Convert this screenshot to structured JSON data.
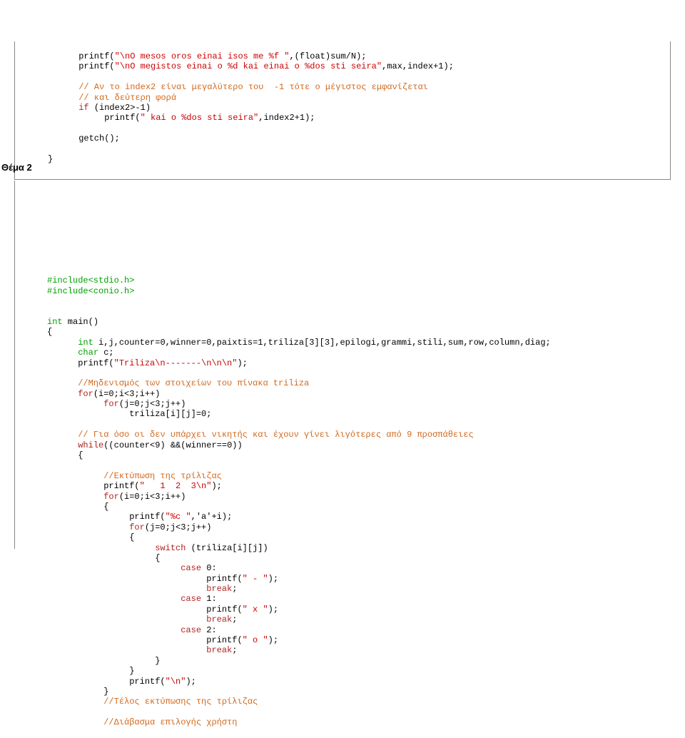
{
  "block1": {
    "l1a": "      printf(",
    "l1b": "\"\\nO mesos oros einai isos me %f \"",
    "l1c": ",(float)sum/N);",
    "l2a": "      printf(",
    "l2b": "\"\\nO megistos einai o %d kai einai o %dos sti seira\"",
    "l2c": ",max,index+1);",
    "l3": "      // Αν το index2 είναι μεγαλύτερο του  -1 τότε ο μέγιστος εμφανίζεται",
    "l4": "      // και δεύτερη φορά",
    "l5a": "      ",
    "l5b": "if",
    "l5c": " (index2>-1)",
    "l6a": "           printf(",
    "l6b": "\" kai o %dos sti seira\"",
    "l6c": ",index2+1);",
    "l7": "      getch();",
    "l8": "}"
  },
  "label": "Θέμα 2",
  "block2": {
    "inc1": "#include<stdio.h>",
    "inc2": "#include<conio.h>",
    "m1a": "int",
    "m1b": " main()",
    "m2": "{",
    "m3a": "      ",
    "m3b": "int",
    "m3c": " i,j,counter=0,winner=0,paixtis=1,triliza[3][3],epilogi,grammi,stili,sum,row,column,diag;",
    "m4a": "      ",
    "m4b": "char",
    "m4c": " c;",
    "m5a": "      printf(",
    "m5b": "\"Triliza\\n-------\\n\\n\\n\"",
    "m5c": ");",
    "m6": "      //Μηδενισμός των στοιχείων του πίνακα triliza",
    "m7a": "      ",
    "m7b": "for",
    "m7c": "(i=0;i<3;i++)",
    "m8a": "           ",
    "m8b": "for",
    "m8c": "(j=0;j<3;j++)",
    "m9": "                triliza[i][j]=0;",
    "m10": "      // Για όσο οι δεν υπάρχει νικητής και έχουν γίνει λιγότερες από 9 προσπάθειες",
    "m11a": "      ",
    "m11b": "while",
    "m11c": "((counter<9) &&(winner==0))",
    "m12": "      {",
    "m13": "           //Εκτύπωση της τρίλιζας",
    "m14a": "           printf(",
    "m14b": "\"   1  2  3\\n\"",
    "m14c": ");",
    "m15a": "           ",
    "m15b": "for",
    "m15c": "(i=0;i<3;i++)",
    "m16": "           {",
    "m17a": "                printf(",
    "m17b": "\"%c \"",
    "m17c": ",'a'+i);",
    "m18a": "                ",
    "m18b": "for",
    "m18c": "(j=0;j<3;j++)",
    "m19": "                {",
    "m20a": "                     ",
    "m20b": "switch",
    "m20c": " (triliza[i][j])",
    "m21": "                     {",
    "m22a": "                          ",
    "m22b": "case",
    "m22c": " 0:",
    "m23a": "                               printf(",
    "m23b": "\" - \"",
    "m23c": ");",
    "m24a": "                               ",
    "m24b": "break",
    "m24c": ";",
    "m25a": "                          ",
    "m25b": "case",
    "m25c": " 1:",
    "m26a": "                               printf(",
    "m26b": "\" x \"",
    "m26c": ");",
    "m27a": "                               ",
    "m27b": "break",
    "m27c": ";",
    "m28a": "                          ",
    "m28b": "case",
    "m28c": " 2:",
    "m29a": "                               printf(",
    "m29b": "\" o \"",
    "m29c": ");",
    "m30a": "                               ",
    "m30b": "break",
    "m30c": ";",
    "m31": "                     }",
    "m32": "                }",
    "m33a": "                printf(",
    "m33b": "\"\\n\"",
    "m33c": ");",
    "m34": "           }",
    "m35": "           //Τέλος εκτύπωσης της τρίλιζας",
    "m36": "           //Διάβασμα επιλογής χρήστη"
  }
}
